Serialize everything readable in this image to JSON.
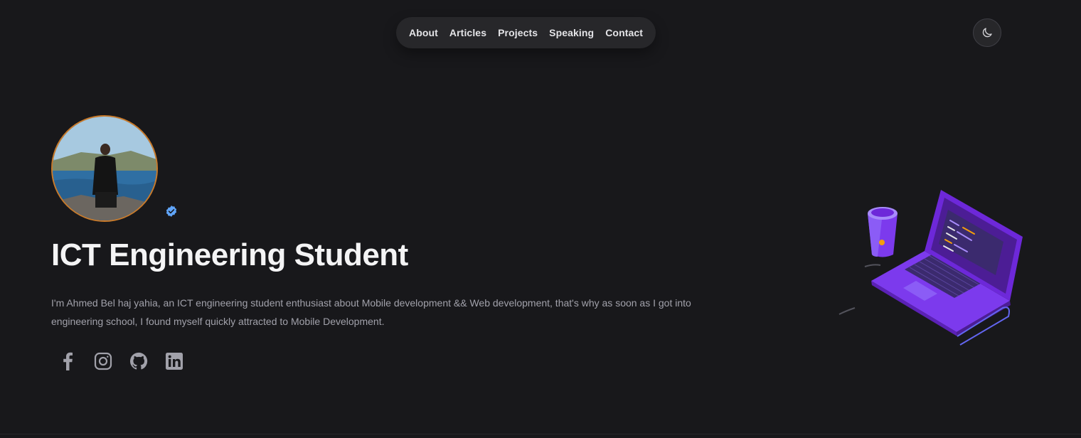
{
  "nav": {
    "items": [
      {
        "label": "About"
      },
      {
        "label": "Articles"
      },
      {
        "label": "Projects"
      },
      {
        "label": "Speaking"
      },
      {
        "label": "Contact"
      }
    ]
  },
  "theme_toggle": {
    "icon": "moon-icon"
  },
  "hero": {
    "avatar_icon": "avatar",
    "verified_icon": "verified-badge-icon",
    "title": "ICT Engineering Student",
    "bio": "I'm Ahmed Bel haj yahia, an ICT engineering student enthusiast about Mobile development && Web development, that's why as soon as I got into engineering school, I found myself quickly attracted to Mobile Development."
  },
  "socials": [
    {
      "icon": "facebook-icon"
    },
    {
      "icon": "instagram-icon"
    },
    {
      "icon": "github-icon"
    },
    {
      "icon": "linkedin-icon"
    }
  ],
  "colors": {
    "background": "#18181b",
    "nav_bg": "#27272a",
    "accent": "#8b5cf6",
    "verified": "#60a5fa",
    "avatar_ring": "#c97a2a"
  }
}
